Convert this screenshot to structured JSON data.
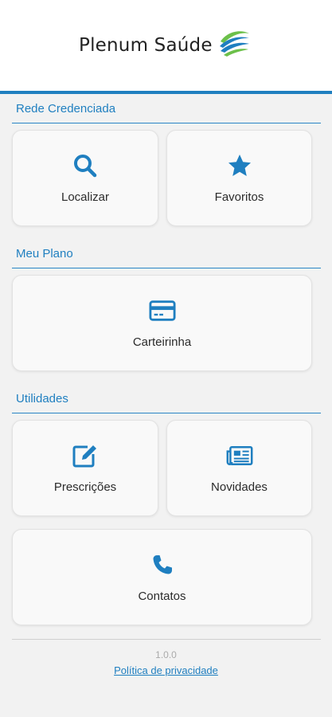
{
  "brand": {
    "name": "Plenum Saúde"
  },
  "colors": {
    "accent": "#1f7fc0",
    "logo_green": "#6cc04a",
    "logo_blue": "#1f7fc0"
  },
  "sections": {
    "rede": {
      "title": "Rede Credenciada"
    },
    "plano": {
      "title": "Meu Plano"
    },
    "utilidades": {
      "title": "Utilidades"
    }
  },
  "cards": {
    "localizar": {
      "label": "Localizar",
      "icon": "search-icon"
    },
    "favoritos": {
      "label": "Favoritos",
      "icon": "star-icon"
    },
    "carteirinha": {
      "label": "Carteirinha",
      "icon": "credit-card-icon"
    },
    "prescricoes": {
      "label": "Prescrições",
      "icon": "edit-icon"
    },
    "novidades": {
      "label": "Novidades",
      "icon": "newspaper-icon"
    },
    "contatos": {
      "label": "Contatos",
      "icon": "phone-icon"
    }
  },
  "footer": {
    "version": "1.0.0",
    "privacy_link": "Política de privacidade"
  }
}
